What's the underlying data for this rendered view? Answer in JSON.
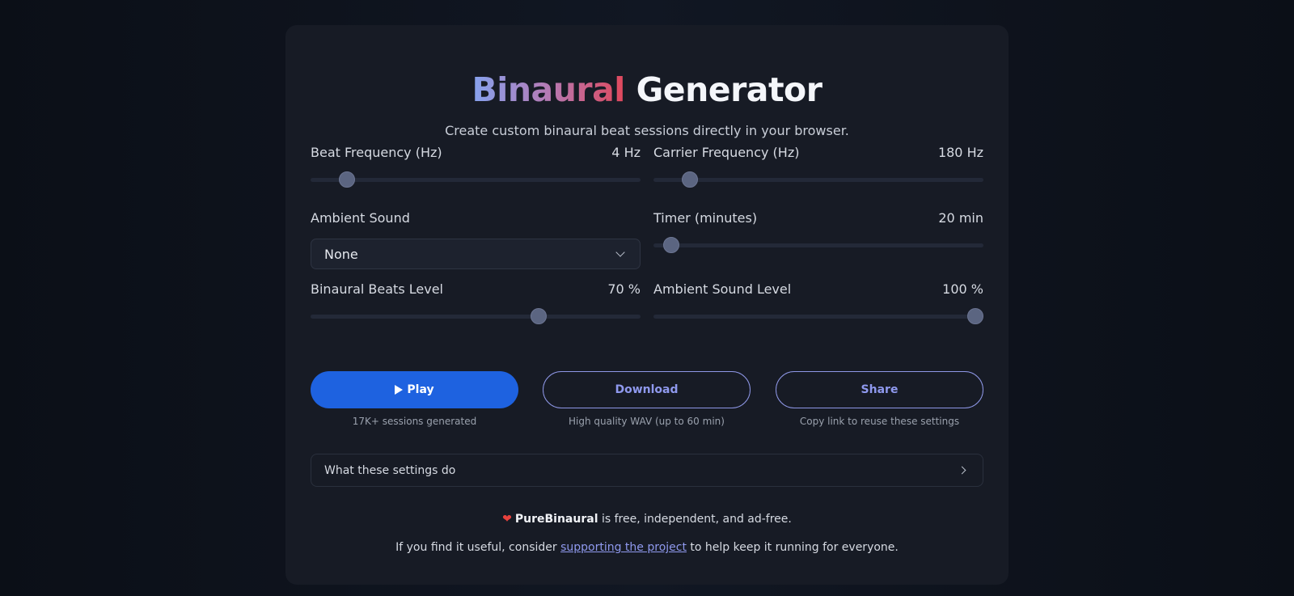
{
  "header": {
    "title_gradient": "Binaural",
    "title_plain": "Generator",
    "subtitle": "Create custom binaural beat sessions directly in your browser."
  },
  "controls": {
    "beat_frequency": {
      "label": "Beat Frequency (Hz)",
      "value_text": "4 Hz",
      "fraction": 0.11
    },
    "carrier_frequency": {
      "label": "Carrier Frequency (Hz)",
      "value_text": "180 Hz",
      "fraction": 0.11
    },
    "ambient_sound": {
      "label": "Ambient Sound",
      "selected": "None"
    },
    "timer": {
      "label": "Timer (minutes)",
      "value_text": "20 min",
      "fraction": 0.055
    },
    "binaural_level": {
      "label": "Binaural Beats Level",
      "value_text": "70 %",
      "fraction": 0.69
    },
    "ambient_level": {
      "label": "Ambient Sound Level",
      "value_text": "100 %",
      "fraction": 0.975
    }
  },
  "actions": {
    "play_label": "Play",
    "play_caption": "17K+ sessions generated",
    "download_label": "Download",
    "download_caption": "High quality WAV (up to 60 min)",
    "share_label": "Share",
    "share_caption": "Copy link to reuse these settings"
  },
  "details": {
    "label": "What these settings do"
  },
  "footer": {
    "brand": "PureBinaural",
    "line1_rest": " is free, independent, and ad-free.",
    "line2_before": "If you find it useful, consider ",
    "line2_link": "supporting the project",
    "line2_after": " to help keep it running for everyone."
  },
  "icons": {
    "play": "play-icon",
    "chevron_down": "chevron-down-icon",
    "chevron_right": "chevron-right-icon",
    "heart": "heart-icon"
  },
  "colors": {
    "accent": "#1e62e0",
    "outline": "#8e97e6",
    "background": "#171b25",
    "heart": "#e8413d"
  }
}
